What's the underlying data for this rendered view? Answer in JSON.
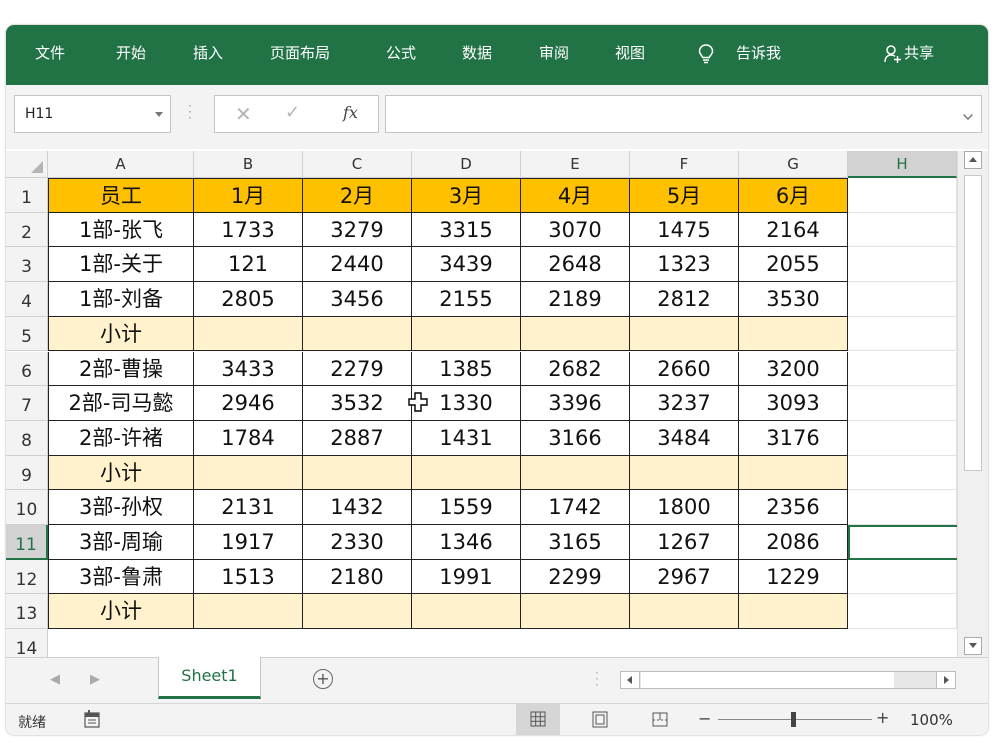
{
  "ribbon": {
    "tabs": [
      "文件",
      "开始",
      "插入",
      "页面布局",
      "公式",
      "数据",
      "审阅",
      "视图"
    ],
    "tell_me": "告诉我",
    "share": "共享",
    "icons": {
      "tell_me": "lightbulb-icon",
      "share": "person-share-icon"
    }
  },
  "formula_bar": {
    "name_box": "H11",
    "cancel_symbol": "✕",
    "enter_symbol": "✓",
    "fx_symbol": "fx",
    "formula": ""
  },
  "sheet": {
    "columns": [
      "A",
      "B",
      "C",
      "D",
      "E",
      "F",
      "G",
      "H"
    ],
    "selected_column": "H",
    "row_numbers": [
      "1",
      "2",
      "3",
      "4",
      "5",
      "6",
      "7",
      "8",
      "9",
      "10",
      "11",
      "12",
      "13",
      "14"
    ],
    "selected_row": "11",
    "selected_cell": "H11",
    "rows": [
      {
        "type": "header",
        "cells": [
          "员工",
          "1月",
          "2月",
          "3月",
          "4月",
          "5月",
          "6月"
        ]
      },
      {
        "type": "data",
        "cells": [
          "1部-张飞",
          "1733",
          "3279",
          "3315",
          "3070",
          "1475",
          "2164"
        ]
      },
      {
        "type": "data",
        "cells": [
          "1部-关于",
          "121",
          "2440",
          "3439",
          "2648",
          "1323",
          "2055"
        ]
      },
      {
        "type": "data",
        "cells": [
          "1部-刘备",
          "2805",
          "3456",
          "2155",
          "2189",
          "2812",
          "3530"
        ]
      },
      {
        "type": "subtotal",
        "cells": [
          "小计",
          "",
          "",
          "",
          "",
          "",
          ""
        ]
      },
      {
        "type": "data",
        "cells": [
          "2部-曹操",
          "3433",
          "2279",
          "1385",
          "2682",
          "2660",
          "3200"
        ]
      },
      {
        "type": "data",
        "cells": [
          "2部-司马懿",
          "2946",
          "3532",
          "1330",
          "3396",
          "3237",
          "3093"
        ]
      },
      {
        "type": "data",
        "cells": [
          "2部-许褚",
          "1784",
          "2887",
          "1431",
          "3166",
          "3484",
          "3176"
        ]
      },
      {
        "type": "subtotal",
        "cells": [
          "小计",
          "",
          "",
          "",
          "",
          "",
          ""
        ]
      },
      {
        "type": "data",
        "cells": [
          "3部-孙权",
          "2131",
          "1432",
          "1559",
          "1742",
          "1800",
          "2356"
        ]
      },
      {
        "type": "data",
        "cells": [
          "3部-周瑜",
          "1917",
          "2330",
          "1346",
          "3165",
          "1267",
          "2086"
        ]
      },
      {
        "type": "data",
        "cells": [
          "3部-鲁肃",
          "1513",
          "2180",
          "1991",
          "2299",
          "2967",
          "1229"
        ]
      },
      {
        "type": "subtotal",
        "cells": [
          "小计",
          "",
          "",
          "",
          "",
          "",
          ""
        ]
      }
    ],
    "colors": {
      "header_fill": "#FFC000",
      "subtotal_fill": "#FFF2CC",
      "accent": "#217346"
    }
  },
  "tabs_bar": {
    "sheet_tab": "Sheet1",
    "add_symbol": "+"
  },
  "status_bar": {
    "ready": "就绪",
    "zoom": "100%",
    "zoom_minus": "−",
    "zoom_plus": "+"
  }
}
